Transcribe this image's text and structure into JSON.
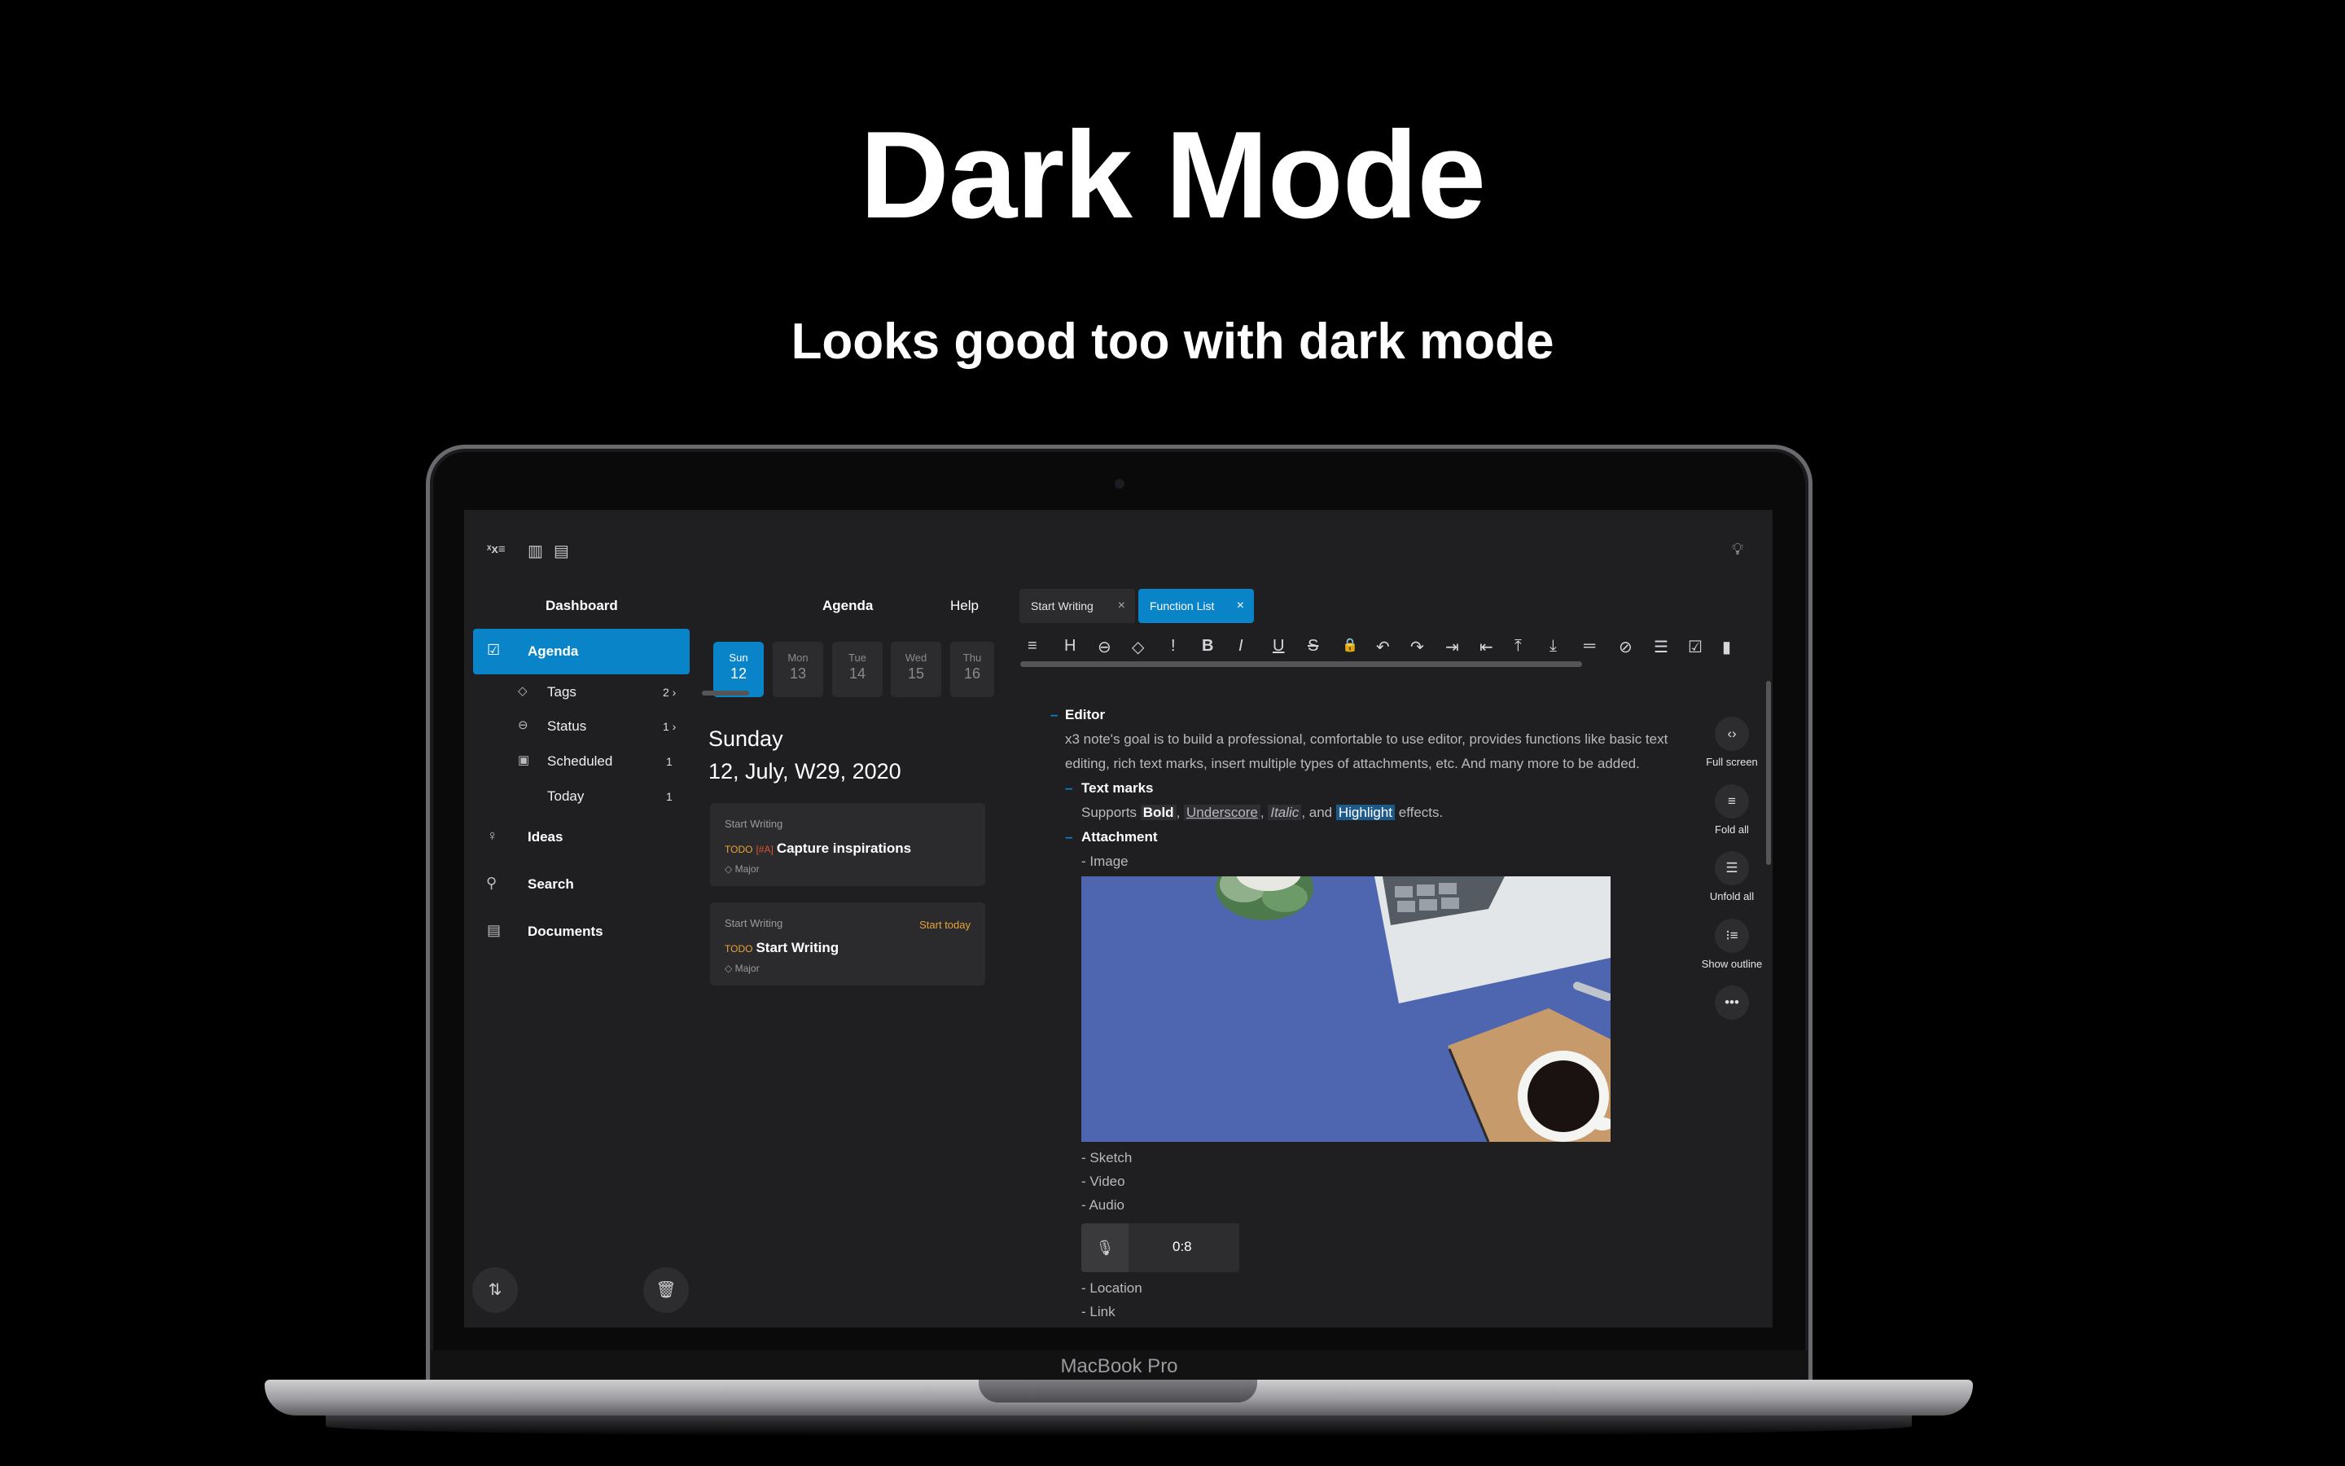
{
  "hero": {
    "title": "Dark Mode",
    "subtitle": "Looks good too with dark mode"
  },
  "device": {
    "brand": "MacBook Pro"
  },
  "app": {
    "logo": "x3 logo",
    "sidebar": {
      "heading": "Dashboard",
      "items": [
        {
          "label": "Agenda",
          "icon": "checkbox-icon",
          "active": true
        },
        {
          "label": "Tags",
          "icon": "tag-icon",
          "count": "2"
        },
        {
          "label": "Status",
          "icon": "status-icon",
          "count": "1"
        },
        {
          "label": "Scheduled",
          "icon": "calendar-icon",
          "count": "1"
        },
        {
          "label": "Today",
          "count": "1"
        },
        {
          "label": "Ideas",
          "icon": "lightbulb-icon"
        },
        {
          "label": "Search",
          "icon": "search-icon"
        },
        {
          "label": "Documents",
          "icon": "document-icon"
        }
      ]
    },
    "agenda": {
      "heading": "Agenda",
      "help": "Help",
      "days": [
        {
          "name": "Sun",
          "num": "12"
        },
        {
          "name": "Mon",
          "num": "13"
        },
        {
          "name": "Tue",
          "num": "14"
        },
        {
          "name": "Wed",
          "num": "15"
        },
        {
          "name": "Thu",
          "num": "16"
        }
      ],
      "weekday": "Sunday",
      "date": "12, July,  W29, 2020",
      "cards": [
        {
          "source": "Start Writing",
          "keyword": "TODO",
          "priority": "[#A]",
          "title": "Capture inspirations",
          "tag": "Major"
        },
        {
          "source": "Start Writing",
          "keyword": "TODO",
          "title": "Start Writing",
          "tag": "Major",
          "badge": "Start today"
        }
      ]
    },
    "editor": {
      "tabs": [
        {
          "label": "Start Writing",
          "active": false
        },
        {
          "label": "Function List",
          "active": true
        }
      ],
      "toolbar": [
        "≡",
        "H",
        "⊖",
        "◇",
        "!",
        "B",
        "I",
        "U",
        "S",
        "🔒",
        "↶",
        "↷",
        "⇥",
        "⇤",
        "⤒",
        "⤓",
        "═",
        "⊘",
        "☰",
        "☑",
        "▮"
      ],
      "heading": "Editor",
      "intro_line1": "x3 note's goal is to build a professional, comfortable to use editor, provides functions like basic text",
      "intro_line2": "editing, rich text marks, insert multiple types of attachments, etc. And many more to be added.",
      "text_marks_heading": "Text marks",
      "supports": "Supports",
      "bold": "Bold",
      "underscore": "Underscore",
      "italic": "Italic",
      "and": ", and",
      "highlight": "Highlight",
      "effects": "effects.",
      "attachment_heading": "Attachment",
      "image": "- Image",
      "sketch": "- Sketch",
      "video": "- Video",
      "audio": "- Audio",
      "audio_time": "0:8",
      "location": "- Location",
      "link": "- Link"
    },
    "side_actions": [
      {
        "label": "Full screen",
        "icon": "expand-icon"
      },
      {
        "label": "Fold all",
        "icon": "fold-icon"
      },
      {
        "label": "Unfold all",
        "icon": "unfold-icon"
      },
      {
        "label": "Show outline",
        "icon": "outline-icon"
      },
      {
        "label": "",
        "icon": "more-icon"
      }
    ]
  }
}
